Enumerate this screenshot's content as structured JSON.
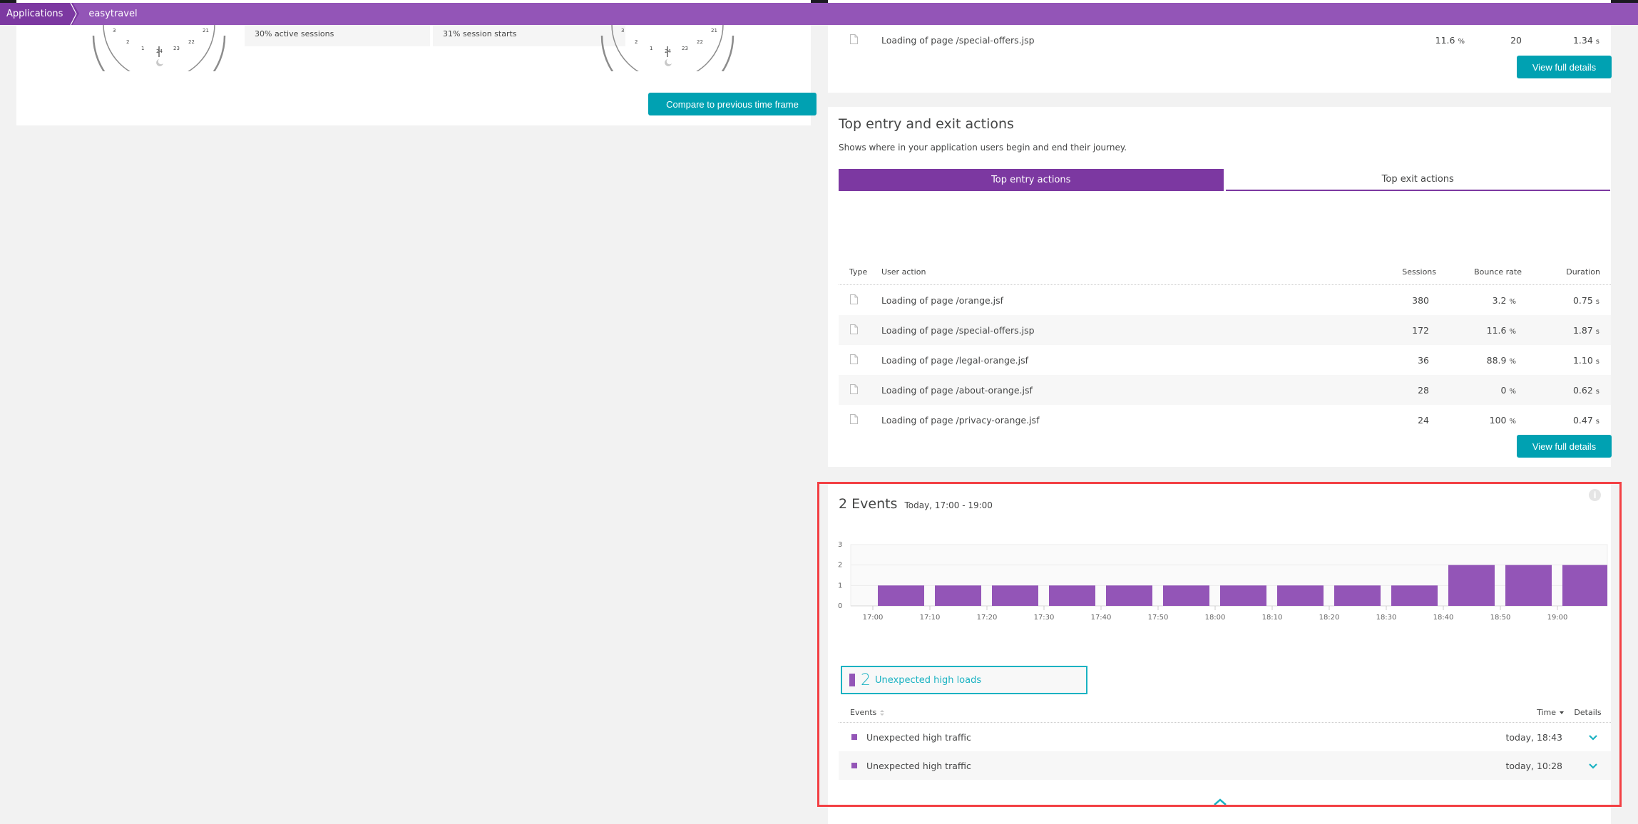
{
  "top_strip": {
    "segments": [
      {
        "name": "green",
        "color": "#7dc540"
      },
      {
        "name": "red",
        "color": "#dc172a"
      }
    ]
  },
  "breadcrumb": {
    "items": [
      "Applications",
      "easytravel"
    ]
  },
  "left_panel": {
    "clock_left_labels": [
      "3",
      "2",
      "1",
      "24",
      "23",
      "22",
      "21"
    ],
    "clock_right_labels": [
      "3",
      "2",
      "1",
      "24",
      "23",
      "22",
      "21"
    ],
    "stat_active_sessions": "30% active sessions",
    "stat_session_starts": "31% session starts",
    "compare_button": "Compare to previous time frame"
  },
  "top_card": {
    "row": {
      "action": "Loading of page /special-offers.jsp",
      "bounce": "11.6",
      "bounce_unit": "%",
      "sessions": "20",
      "duration": "1.34",
      "duration_unit": "s"
    },
    "view_full_details": "View full details"
  },
  "entry_exit": {
    "title": "Top entry and exit actions",
    "subtitle": "Shows where in your application users begin and end their journey.",
    "tabs": [
      {
        "label": "Top entry actions",
        "active": true
      },
      {
        "label": "Top exit actions",
        "active": false
      }
    ],
    "columns": {
      "type": "Type",
      "action": "User action",
      "sessions": "Sessions",
      "bounce": "Bounce rate",
      "duration": "Duration"
    },
    "rows": [
      {
        "action": "Loading of page /orange.jsf",
        "sessions": "380",
        "bounce": "3.2",
        "duration": "0.75"
      },
      {
        "action": "Loading of page /special-offers.jsp",
        "sessions": "172",
        "bounce": "11.6",
        "duration": "1.87"
      },
      {
        "action": "Loading of page /legal-orange.jsf",
        "sessions": "36",
        "bounce": "88.9",
        "duration": "1.10"
      },
      {
        "action": "Loading of page /about-orange.jsf",
        "sessions": "28",
        "bounce": "0",
        "duration": "0.62"
      },
      {
        "action": "Loading of page /privacy-orange.jsf",
        "sessions": "24",
        "bounce": "100",
        "duration": "0.47"
      }
    ],
    "bounce_unit": "%",
    "duration_unit": "s",
    "view_full_details": "View full details"
  },
  "events": {
    "count_title": "2 Events",
    "timeframe": "Today, 17:00 - 19:00",
    "legend": {
      "count": "2",
      "label": "Unexpected high loads",
      "color": "#9355b7"
    },
    "table": {
      "col_events": "Events",
      "col_time": "Time",
      "col_details": "Details",
      "rows": [
        {
          "name": "Unexpected high traffic",
          "time": "today, 18:43"
        },
        {
          "name": "Unexpected high traffic",
          "time": "today, 10:28"
        }
      ]
    }
  },
  "chart_data": {
    "type": "bar",
    "title": "2 Events",
    "xlabel": "",
    "ylabel": "",
    "ylim": [
      0,
      3
    ],
    "yticks": [
      "0",
      "1",
      "2",
      "3"
    ],
    "grid": true,
    "x_tick_labels": [
      "17:00",
      "17:10",
      "17:20",
      "17:30",
      "17:40",
      "17:50",
      "18:00",
      "18:10",
      "18:20",
      "18:30",
      "18:40",
      "18:50",
      "19:00"
    ],
    "categories": [
      "17:05",
      "17:15",
      "17:25",
      "17:35",
      "17:45",
      "17:55",
      "18:05",
      "18:15",
      "18:25",
      "18:35",
      "18:45",
      "18:55",
      "19:05"
    ],
    "values": [
      1,
      1,
      1,
      1,
      1,
      1,
      1,
      1,
      1,
      1,
      2,
      2,
      2
    ],
    "bar_color": "#9355b7"
  }
}
